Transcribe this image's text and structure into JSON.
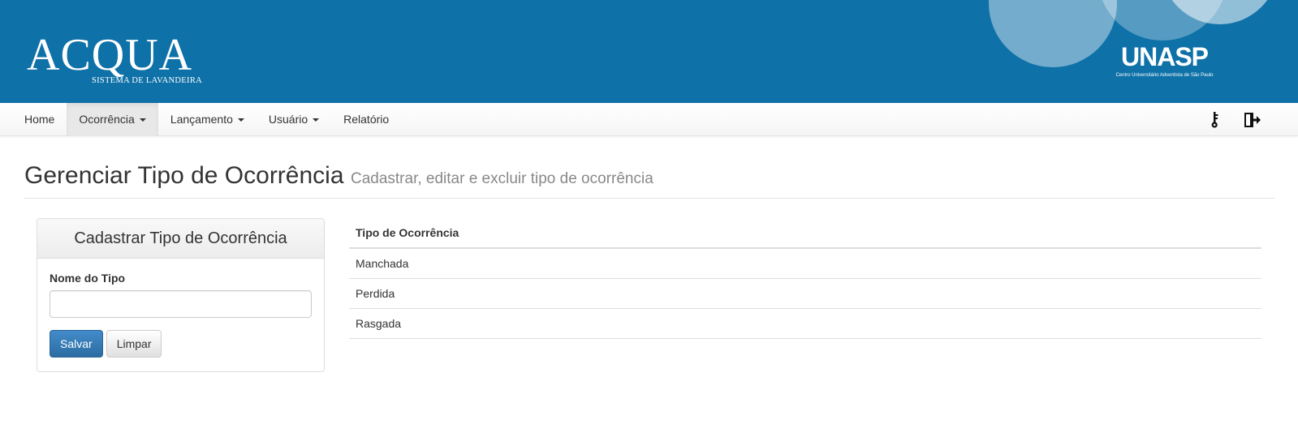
{
  "header": {
    "brand_title": "ACQUA",
    "brand_subtitle": "SISTEMA DE LAVANDEIRA",
    "logo_text": "UNASP",
    "logo_subtitle": "Centro Universitário Adventista de São Paulo",
    "background_color": "#0e71a8"
  },
  "navbar": {
    "items": [
      {
        "label": "Home",
        "dropdown": false,
        "active": false
      },
      {
        "label": "Ocorrência",
        "dropdown": true,
        "active": true
      },
      {
        "label": "Lançamento",
        "dropdown": true,
        "active": false
      },
      {
        "label": "Usuário",
        "dropdown": true,
        "active": false
      },
      {
        "label": "Relatório",
        "dropdown": false,
        "active": false
      }
    ],
    "right_icons": [
      "key-icon",
      "logout-icon"
    ]
  },
  "page": {
    "title": "Gerenciar Tipo de Ocorrência",
    "subtitle": "Cadastrar, editar e excluir tipo de ocorrência"
  },
  "form": {
    "heading": "Cadastrar Tipo de Ocorrência",
    "name_label": "Nome do Tipo",
    "name_value": "",
    "save_label": "Salvar",
    "clear_label": "Limpar",
    "primary_color": "#337ab7"
  },
  "table": {
    "header": "Tipo de Ocorrência",
    "rows": [
      "Manchada",
      "Perdida",
      "Rasgada"
    ]
  }
}
